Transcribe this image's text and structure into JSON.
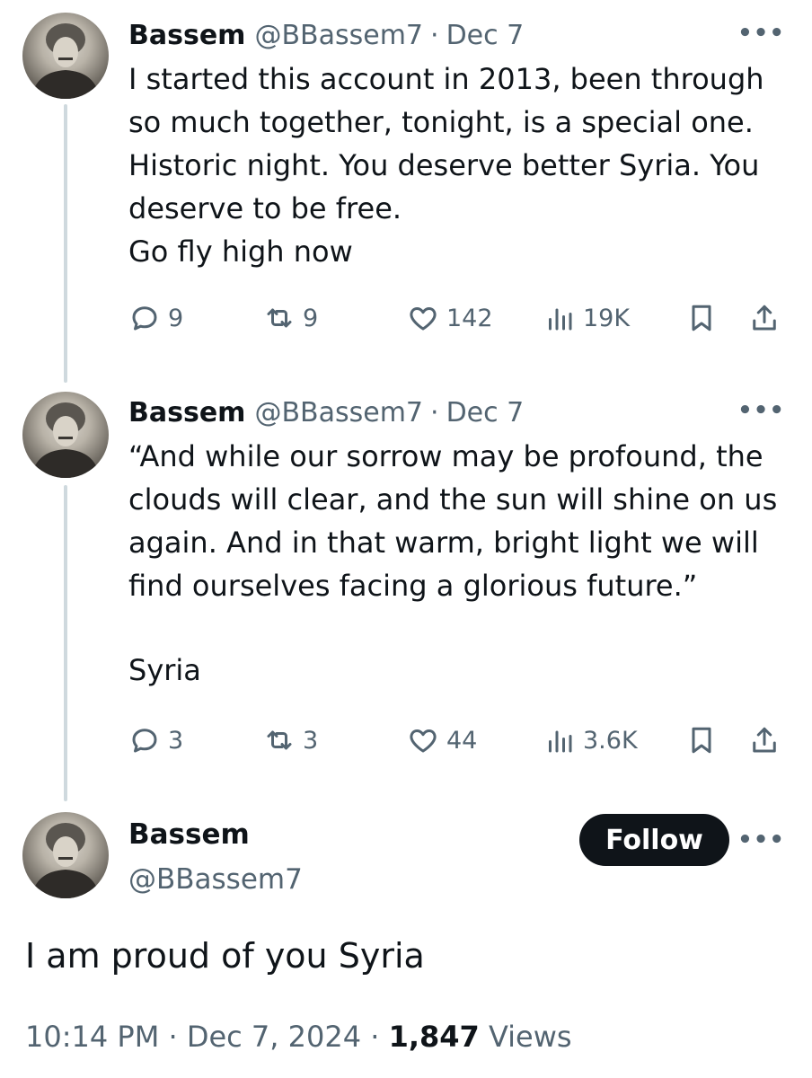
{
  "thread": [
    {
      "name": "Bassem",
      "handle": "@BBassem7",
      "separator": "·",
      "date": "Dec 7",
      "more_icon": "more-horizontal-icon",
      "lines": [
        "I started this account in 2013, been through",
        "so much together, tonight, is a special one.",
        "Historic night. You deserve better Syria. You",
        "deserve to be free.",
        "Go fly high now"
      ],
      "stats": {
        "replies": "9",
        "reposts": "9",
        "likes": "142",
        "views": "19K"
      }
    },
    {
      "name": "Bassem",
      "handle": "@BBassem7",
      "separator": "·",
      "date": "Dec 7",
      "more_icon": "more-horizontal-icon",
      "lines": [
        "“And while our sorrow may be profound, the",
        "clouds will clear, and the sun will shine on us",
        "again. And in that warm, bright light we will",
        "find ourselves facing a glorious future.”"
      ],
      "lines_after_gap": [
        "Syria"
      ],
      "stats": {
        "replies": "3",
        "reposts": "3",
        "likes": "44",
        "views": "3.6K"
      }
    }
  ],
  "main_tweet": {
    "name": "Bassem",
    "handle": "@BBassem7",
    "follow_label": "Follow",
    "text": "I am proud of you Syria",
    "time": "10:14 PM",
    "separator": "·",
    "date": "Dec 7, 2024",
    "views_count": "1,847",
    "views_label": "Views"
  },
  "more_glyph": "•••",
  "colors": {
    "text": "#0f1419",
    "secondary": "#536471",
    "thread_line": "#cfd9de",
    "button_bg": "#0f1419",
    "button_text": "#ffffff"
  }
}
